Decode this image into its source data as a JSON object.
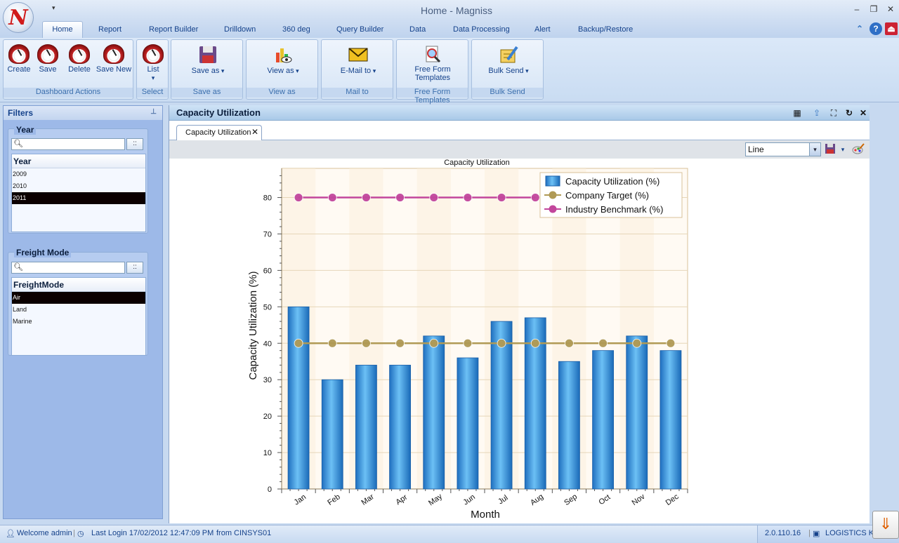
{
  "window": {
    "title": "Home - Magniss",
    "logo_letter": "N",
    "qat_arrow": "▾",
    "minimize": "–",
    "restore": "❐",
    "close": "✕"
  },
  "ribbon_tabs": [
    "Home",
    "Report",
    "Report Builder",
    "Drilldown",
    "360 deg",
    "Query Builder",
    "Data",
    "Data Processing",
    "Alert",
    "Backup/Restore"
  ],
  "ribbon_right": {
    "collapse": "⌃",
    "help": "?",
    "exit": "⏏"
  },
  "ribbon": {
    "dashboard_actions": {
      "label": "Dashboard Actions",
      "create": "Create",
      "save": "Save",
      "delete": "Delete",
      "save_new": "Save New"
    },
    "select": {
      "label": "Select",
      "list": "List",
      "list_arrow": "▾"
    },
    "save_as": {
      "label": "Save as",
      "button": "Save as"
    },
    "view_as": {
      "label": "View as",
      "button": "View as"
    },
    "mail_to": {
      "label": "Mail to",
      "button": "E-Mail to"
    },
    "free_form": {
      "label": "Free Form Templates",
      "button_line1": "Free Form",
      "button_line2": "Templates"
    },
    "bulk_send": {
      "label": "Bulk Send",
      "button": "Bulk Send"
    }
  },
  "filters": {
    "title": "Filters",
    "pin": "⊥",
    "year": {
      "title": "Year",
      "search_placeholder": "",
      "go": "::",
      "column": "Year",
      "items": [
        "2009",
        "2010",
        "2011"
      ],
      "selected": "2011"
    },
    "freight": {
      "title": "Freight Mode",
      "search_placeholder": "",
      "go": "::",
      "column": "FreightMode",
      "items": [
        "Air",
        "Land",
        "Marine"
      ],
      "selected": "Air"
    }
  },
  "main": {
    "title": "Capacity Utilization",
    "tab": "Capacity Utilization",
    "tab_close": "✕",
    "chart_type": "Line",
    "select_arrow": "▾",
    "header_icons": {
      "grid": "▦",
      "export": "⇪",
      "maximize": "⛶",
      "refresh": "↻",
      "close": "✕"
    }
  },
  "chart_data": {
    "type": "bar",
    "title": "Capacity Utilization",
    "xlabel": "Month",
    "ylabel": "Capacity Utilization (%)",
    "categories": [
      "Jan",
      "Feb",
      "Mar",
      "Apr",
      "May",
      "Jun",
      "Jul",
      "Aug",
      "Sep",
      "Oct",
      "Nov",
      "Dec"
    ],
    "series": [
      {
        "name": "Capacity Utilization (%)",
        "kind": "bar",
        "color": "#2b8fdc",
        "values": [
          50,
          30,
          34,
          34,
          42,
          36,
          46,
          47,
          35,
          38,
          42,
          38
        ]
      },
      {
        "name": "Company Target (%)",
        "kind": "line",
        "color": "#b09a55",
        "values": [
          40,
          40,
          40,
          40,
          40,
          40,
          40,
          40,
          40,
          40,
          40,
          40
        ]
      },
      {
        "name": "Industry Benchmark (%)",
        "kind": "line",
        "color": "#c2469c",
        "values": [
          80,
          80,
          80,
          80,
          80,
          80,
          80,
          80,
          null,
          null,
          null,
          null
        ]
      }
    ],
    "ylim": [
      0,
      88
    ],
    "yticks": [
      0,
      10,
      20,
      30,
      40,
      50,
      60,
      70,
      80
    ],
    "legend": "top-right",
    "grid": "horizontal"
  },
  "statusbar": {
    "welcome": "Welcome admin",
    "last_login": "Last Login 17/02/2012 12:47:09 PM",
    "from": "from CINSYS01",
    "version": "2.0.110.16",
    "company": "LOGISTICS KP"
  },
  "alert_button": "⇓"
}
